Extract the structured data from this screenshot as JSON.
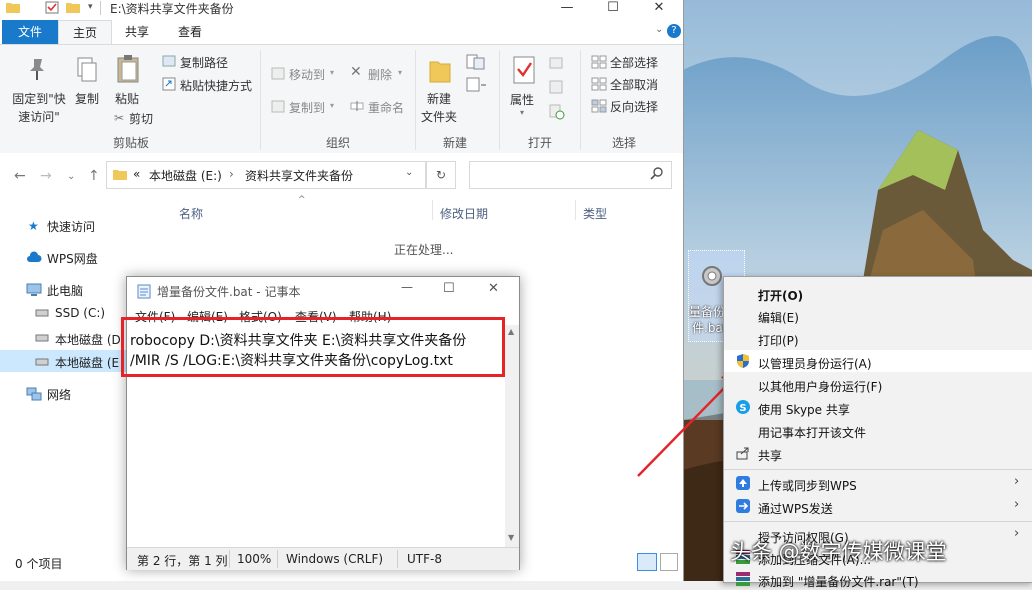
{
  "explorer": {
    "title_path": "E:\\资料共享文件夹备份",
    "tabs": [
      "文件",
      "主页",
      "共享",
      "查看"
    ],
    "clipboard": {
      "pin_label": "固定到\"快速访问\"",
      "copy_label": "复制",
      "paste_label": "粘贴",
      "copy_path": "复制路径",
      "paste_shortcut": "粘贴快捷方式",
      "cut": "剪切",
      "group": "剪贴板"
    },
    "organize": {
      "move_to": "移动到",
      "copy_to": "复制到",
      "delete": "删除",
      "rename": "重命名",
      "group": "组织"
    },
    "new": {
      "new_folder": "新建\n文件夹",
      "new_folder_l1": "新建",
      "new_folder_l2": "文件夹",
      "group": "新建"
    },
    "open": {
      "properties": "属性",
      "group": "打开"
    },
    "select": {
      "select_all": "全部选择",
      "select_none": "全部取消",
      "invert": "反向选择",
      "group": "选择"
    },
    "address": {
      "prefix": "«",
      "segment1": "本地磁盘 (E:)",
      "segment2": "资料共享文件夹备份"
    },
    "nav": {
      "quick_access": "快速访问",
      "wps_cloud": "WPS网盘",
      "this_pc": "此电脑",
      "ssd": "SSD (C:)",
      "disk_d": "本地磁盘 (D",
      "disk_e": "本地磁盘 (E",
      "network": "网络"
    },
    "columns": {
      "name": "名称",
      "modified": "修改日期",
      "type": "类型"
    },
    "processing": "正在处理...",
    "status": "0 个项目"
  },
  "notepad": {
    "title": "增量备份文件.bat - 记事本",
    "menu": [
      "文件(F)",
      "编辑(E)",
      "格式(O)",
      "查看(V)",
      "帮助(H)"
    ],
    "lines": [
      "robocopy D:\\资料共享文件夹  E:\\资料共享文件夹备份",
      "/MIR  /S  /LOG:E:\\资料共享文件夹备份\\copyLog.txt"
    ],
    "status": {
      "position": "第 2 行，第 1 列",
      "zoom": "100%",
      "eol": "Windows (CRLF)",
      "encoding": "UTF-8"
    }
  },
  "desktop": {
    "file_label_1": "量备份",
    "file_label_2": "件.bat"
  },
  "context_menu": {
    "items": [
      {
        "label": "打开(O)",
        "bold": true
      },
      {
        "label": "编辑(E)"
      },
      {
        "label": "打印(P)"
      },
      {
        "label": "以管理员身份运行(A)",
        "icon": "shield-icon",
        "highlight": true
      },
      {
        "label": "以其他用户身份运行(F)"
      },
      {
        "label": "使用 Skype 共享",
        "icon": "skype-icon"
      },
      {
        "label": "用记事本打开该文件"
      },
      {
        "label": "共享",
        "icon": "share-icon"
      },
      {
        "label": "上传或同步到WPS",
        "icon": "upload-icon",
        "submenu": true
      },
      {
        "label": "通过WPS发送",
        "icon": "send-icon",
        "submenu": true
      },
      {
        "label": "授予访问权限(G)",
        "submenu": true
      },
      {
        "label": "添加到压缩文件(A)..."
      },
      {
        "label": "添加到 \"增量备份文件.rar\"(T)"
      }
    ]
  },
  "watermark": "头条 @数字传媒微课堂",
  "colors": {
    "accent": "#1979ca",
    "highlight_box": "#e5242a",
    "arrow": "#e5242a"
  }
}
